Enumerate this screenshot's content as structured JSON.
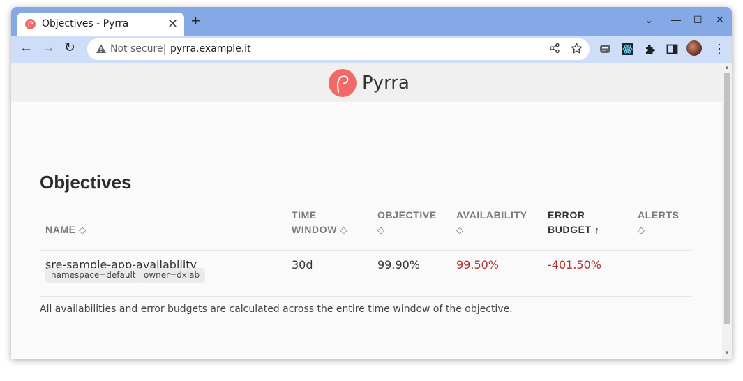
{
  "browser": {
    "tab_title": "Objectives - Pyrra",
    "tab_close": "✕",
    "new_tab": "+",
    "controls": {
      "chevron": "⌄",
      "minimize": "—",
      "maximize": "☐",
      "close": "✕"
    },
    "nav": {
      "back": "←",
      "forward": "→",
      "reload": "↻"
    },
    "security_text": "Not secure",
    "url": "pyrra.example.it",
    "icons": [
      "warning-icon",
      "share-icon",
      "star-icon",
      "extension-chat-icon",
      "extension-react-icon",
      "puzzle-icon",
      "side-panel-icon",
      "profile-avatar",
      "menu-dots-icon"
    ]
  },
  "app": {
    "logo_text": "Pyrra",
    "brand_color": "#f26a68"
  },
  "page": {
    "title": "Objectives",
    "columns": [
      {
        "label": "NAME",
        "sort": "◇"
      },
      {
        "label": "TIME",
        "label2": "WINDOW",
        "sort": "◇"
      },
      {
        "label": "OBJECTIVE",
        "sort": "◇"
      },
      {
        "label": "AVAILABILITY",
        "sort": "◇"
      },
      {
        "label": "ERROR",
        "label2": "BUDGET",
        "sort": "↑"
      },
      {
        "label": "ALERTS",
        "sort": "◇"
      }
    ],
    "rows": [
      {
        "name": "sre-sample-app-availability",
        "labels": [
          "namespace=default",
          "owner=dxlab"
        ],
        "time_window": "30d",
        "objective": "99.90%",
        "availability": "99.50%",
        "error_budget": "-401.50%",
        "alerts": ""
      }
    ],
    "footnote": "All availabilities and error budgets are calculated across the entire time window of the objective."
  },
  "colors": {
    "negative": "#b03030",
    "titlebar": "#85a9e7",
    "toolbar": "#cfdef8"
  }
}
